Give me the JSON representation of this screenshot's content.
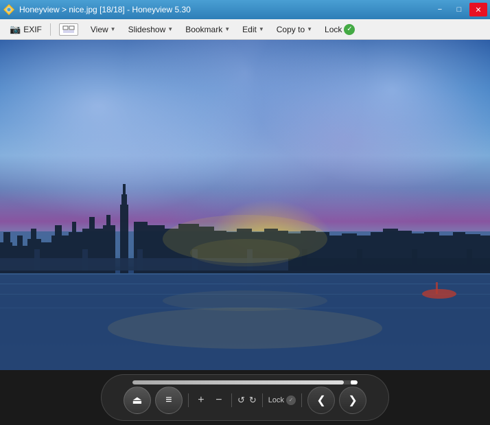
{
  "titlebar": {
    "app_name": "Honeyview",
    "separator1": ">",
    "filename": "nice.jpg [18/18]",
    "separator2": "-",
    "app_version": "Honeyview 5.30",
    "full_title": "Honeyview > nice.jpg [18/18] - Honeyview 5.30",
    "minimize_label": "−",
    "maximize_label": "□",
    "close_label": "✕"
  },
  "menubar": {
    "exif_label": "EXIF",
    "view_label": "View",
    "slideshow_label": "Slideshow",
    "bookmark_label": "Bookmark",
    "edit_label": "Edit",
    "copyto_label": "Copy to",
    "lock_label": "Lock"
  },
  "toolbar": {
    "eject_icon": "⏏",
    "menu_icon": "≡",
    "plus_icon": "+",
    "minus_icon": "−",
    "undo_icon": "↺",
    "redo_icon": "↻",
    "lock_label": "Lock",
    "prev_icon": "❮",
    "next_icon": "❯",
    "progress_pct": 94
  },
  "colors": {
    "titlebar_bg": "#3a8fc4",
    "menubar_bg": "#f0f0f0",
    "toolbar_bg": "#1a1a1a",
    "close_btn": "#e81123"
  }
}
